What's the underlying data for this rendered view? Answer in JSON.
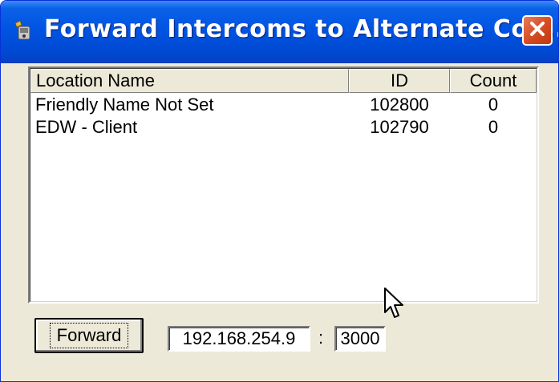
{
  "window": {
    "title": "Forward Intercoms to Alternate Con...",
    "title_icon": "app-icon",
    "close_icon": "close-icon"
  },
  "list": {
    "columns": [
      "Location Name",
      "ID",
      "Count"
    ],
    "rows": [
      {
        "name": "Friendly Name Not Set",
        "id": "102800",
        "count": "0"
      },
      {
        "name": "EDW - Client",
        "id": "102790",
        "count": "0"
      }
    ]
  },
  "controls": {
    "forward_label": "Forward",
    "ip_value": "192.168.254.9",
    "separator": ":",
    "port_value": "3000"
  },
  "colors": {
    "titlebar": "#0054e3",
    "window_bg": "#ece9d8",
    "close_button": "#d54a1f"
  }
}
